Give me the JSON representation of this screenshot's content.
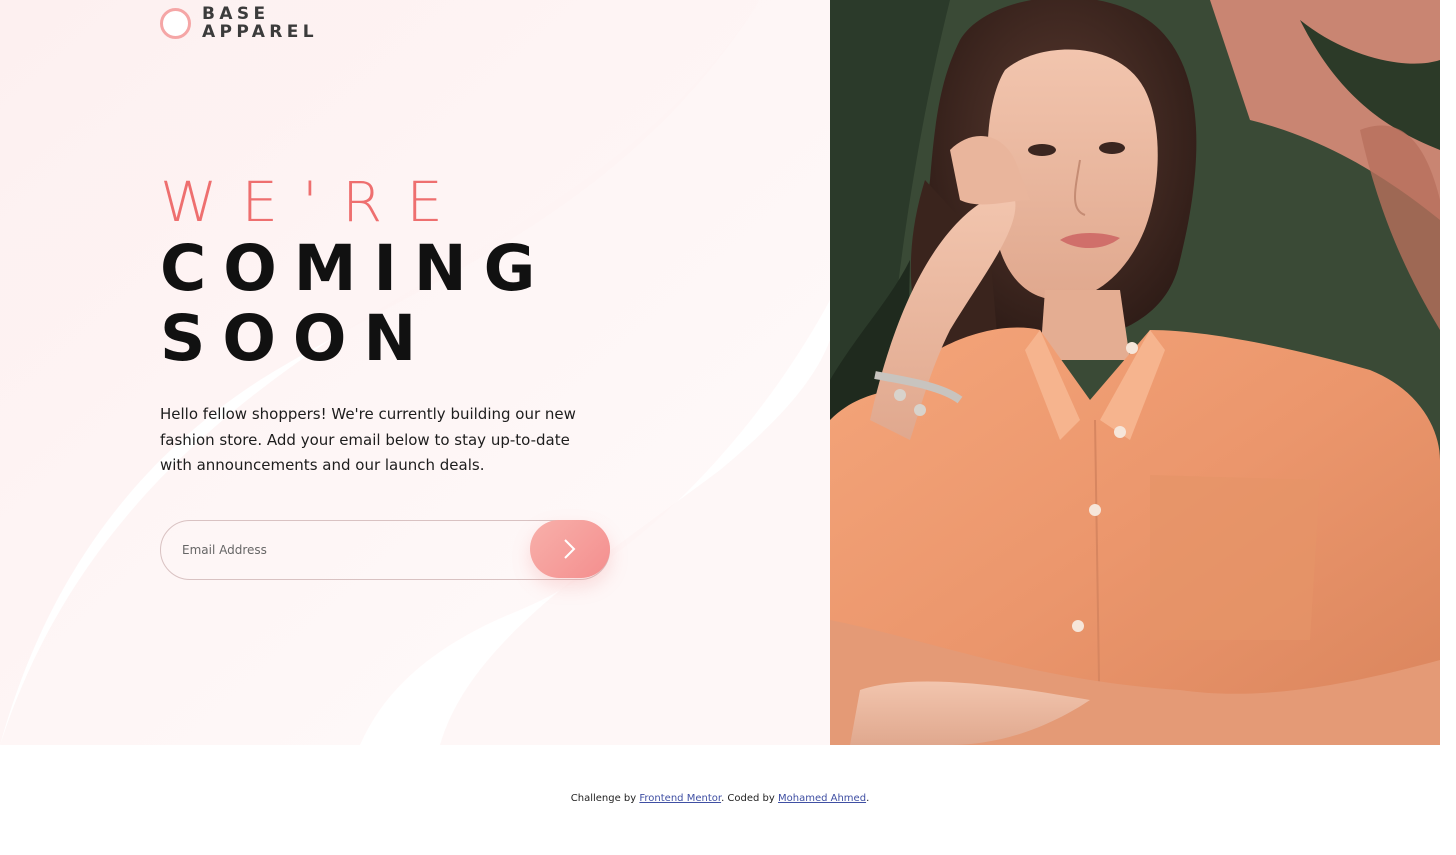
{
  "brand": {
    "line1": "BASE",
    "line2": "APPAREL",
    "logo_icon": "ring-logo-icon",
    "accent_color": "#ee6f6f"
  },
  "hero": {
    "heading_light": "WE'RE",
    "heading_bold_1": "COMING",
    "heading_bold_2": "SOON",
    "intro": "Hello fellow shoppers! We're currently building our new fashion store. Add your email below to stay up-to-date with announcements and our launch deals."
  },
  "form": {
    "email_placeholder": "Email Address",
    "email_value": "",
    "submit_icon": "chevron-right-icon"
  },
  "photo": {
    "subject": "hero-photo-woman-orange-shirt"
  },
  "footer": {
    "prefix": "Challenge by",
    "link1": "Frontend Mentor",
    "middle": ". Coded by",
    "link2": "Mohamed Ahmed",
    "suffix": "."
  }
}
